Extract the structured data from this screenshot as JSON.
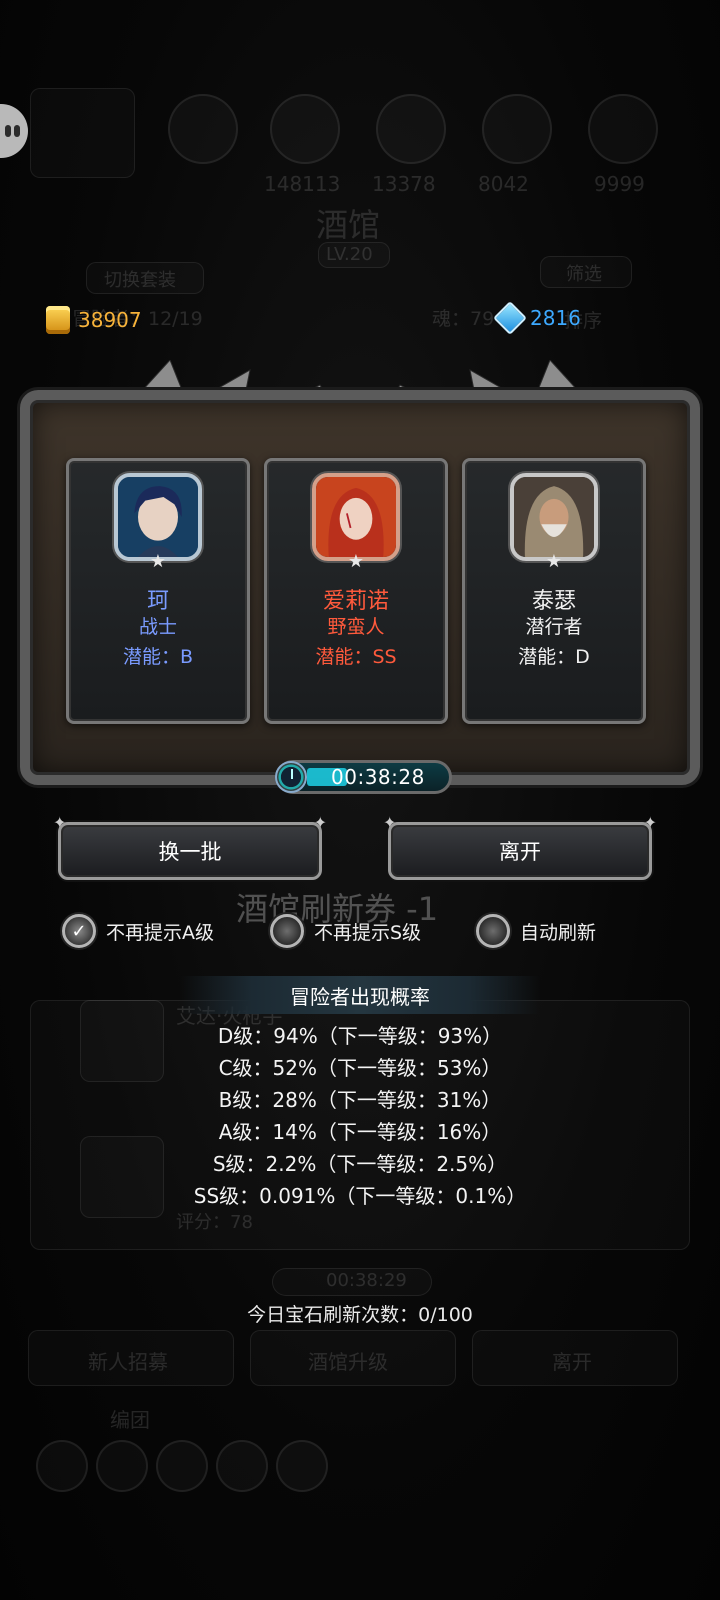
{
  "background": {
    "title": "酒馆",
    "level": "LV.20",
    "switch_suit": "切换套装",
    "filter": "筛选",
    "adventurer_count": "冒险者：12/19",
    "soul": "魂：79",
    "sort": "排序",
    "top_numbers": [
      "148113",
      "13378",
      "8042",
      "9999"
    ],
    "ghost_refresh_ticket": "酒馆刷新券 -1",
    "ghost_hero_name": "艾达·火枪手",
    "ghost_score": "评分：78",
    "ghost_timer": "00:38:29",
    "ghost_buttons": [
      "新人招募",
      "酒馆升级",
      "离开"
    ],
    "ghost_team": "编团"
  },
  "currency": {
    "gold": "38907",
    "gems": "2816",
    "gold_icon": "gold-coin-stack-icon",
    "gem_icon": "blue-crystal-icon"
  },
  "heroes": [
    {
      "name": "珂",
      "class": "战士",
      "potential": "潜能：B",
      "color": "#7a9bff"
    },
    {
      "name": "爱莉诺",
      "class": "野蛮人",
      "potential": "潜能：SS",
      "color": "#ff5a3c"
    },
    {
      "name": "泰瑟",
      "class": "潜行者",
      "potential": "潜能：D",
      "color": "#f0f0f0"
    }
  ],
  "timer": "00:38:28",
  "buttons": {
    "refresh": "换一批",
    "leave": "离开"
  },
  "options": [
    {
      "label": "不再提示A级",
      "checked": true
    },
    {
      "label": "不再提示S级",
      "checked": false
    },
    {
      "label": "自动刷新",
      "checked": false
    }
  ],
  "probability": {
    "title": "冒险者出现概率",
    "lines": [
      "D级：94%（下一等级：93%）",
      "C级：52%（下一等级：53%）",
      "B级：28%（下一等级：31%）",
      "A级：14%（下一等级：16%）",
      "S级：2.2%（下一等级：2.5%）",
      "SS级：0.091%（下一等级：0.1%）"
    ]
  },
  "gem_refresh_count": "今日宝石刷新次数：0/100"
}
